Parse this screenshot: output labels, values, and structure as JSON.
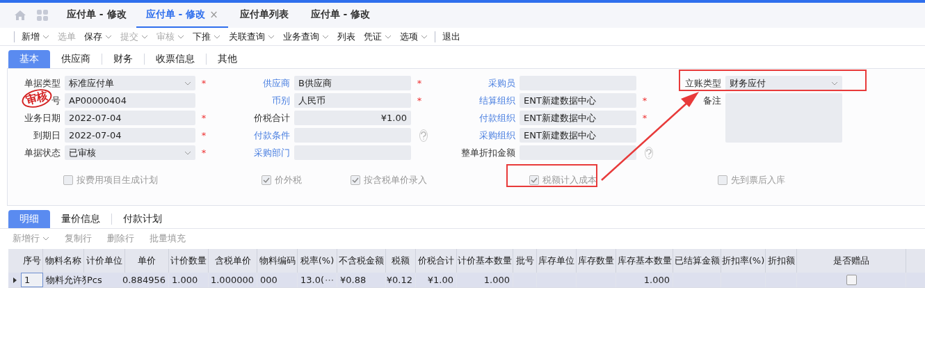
{
  "tabs": [
    {
      "label": "应付单 - 修改",
      "selected": false
    },
    {
      "label": "应付单 - 修改",
      "selected": true,
      "close": "×"
    },
    {
      "label": "应付单列表",
      "selected": false
    },
    {
      "label": "应付单 - 修改",
      "selected": false
    }
  ],
  "toolbar": [
    {
      "label": "新增",
      "menu": true,
      "disabled": false
    },
    {
      "label": "选单",
      "menu": false,
      "disabled": true
    },
    {
      "label": "保存",
      "menu": true,
      "disabled": false
    },
    {
      "label": "提交",
      "menu": true,
      "disabled": true
    },
    {
      "label": "审核",
      "menu": true,
      "disabled": true
    },
    {
      "label": "下推",
      "menu": true,
      "disabled": false
    },
    {
      "label": "关联查询",
      "menu": true,
      "disabled": false
    },
    {
      "label": "业务查询",
      "menu": true,
      "disabled": false
    },
    {
      "label": "列表",
      "menu": false,
      "disabled": false
    },
    {
      "label": "凭证",
      "menu": true,
      "disabled": false
    },
    {
      "label": "选项",
      "menu": true,
      "disabled": false
    },
    {
      "label": "退出",
      "menu": false,
      "disabled": false
    }
  ],
  "form_tabs": [
    {
      "label": "基本",
      "selected": true
    },
    {
      "label": "供应商",
      "selected": false
    },
    {
      "label": "财务",
      "selected": false
    },
    {
      "label": "收票信息",
      "selected": false
    },
    {
      "label": "其他",
      "selected": false
    }
  ],
  "stamp": "审核",
  "form_groups": [
    [
      {
        "label": "单据类型",
        "kind": "select",
        "value": "标准应付单",
        "mark": "*",
        "link": false
      },
      {
        "label": "号",
        "kind": "text",
        "value": "AP00000404",
        "link": false
      },
      {
        "label": "业务日期",
        "kind": "text",
        "value": "2022-07-04",
        "mark": "*",
        "link": false
      },
      {
        "label": "到期日",
        "kind": "text",
        "value": "2022-07-04",
        "mark": "*",
        "link": false
      },
      {
        "label": "单据状态",
        "kind": "select",
        "value": "已审核",
        "mark": "*",
        "link": false
      }
    ],
    [
      {
        "label": "供应商",
        "kind": "text",
        "value": "B供应商",
        "mark": "*",
        "link": true
      },
      {
        "label": "币别",
        "kind": "text",
        "value": "人民币",
        "mark": "*",
        "link": true
      },
      {
        "label": "价税合计",
        "kind": "amount",
        "value": "¥1.00",
        "link": false
      },
      {
        "label": "付款条件",
        "kind": "help",
        "link": true
      },
      {
        "label": "采购部门",
        "kind": "text",
        "link": true
      }
    ],
    [
      {
        "label": "采购员",
        "kind": "text",
        "link": true
      },
      {
        "label": "结算组织",
        "kind": "text",
        "value": "ENT新建数据中心",
        "mark": "*",
        "link": true
      },
      {
        "label": "付款组织",
        "kind": "text",
        "value": "ENT新建数据中心",
        "mark": "*",
        "link": true
      },
      {
        "label": "采购组织",
        "kind": "text",
        "value": "ENT新建数据中心",
        "link": true
      },
      {
        "label": "整单折扣金额",
        "kind": "help",
        "link": false
      }
    ],
    [
      {
        "label": "立账类型",
        "kind": "select",
        "value": "财务应付",
        "link": false
      },
      {
        "label": "备注",
        "kind": "textarea",
        "link": false
      }
    ]
  ],
  "checkboxes": [
    {
      "label": "按费用项目生成计划",
      "checked": false
    },
    {
      "label": "价外税",
      "checked": true
    },
    {
      "label": "按含税单价录入",
      "checked": true
    },
    {
      "label": "税额计入成本",
      "checked": true
    },
    {
      "label": "先到票后入库",
      "checked": false
    }
  ],
  "detail_tabs": [
    {
      "label": "明细",
      "selected": true
    },
    {
      "label": "量价信息",
      "selected": false
    },
    {
      "label": "付款计划",
      "selected": false
    }
  ],
  "detail_toolbar": [
    {
      "label": "新增行",
      "menu": true
    },
    {
      "label": "复制行",
      "menu": false
    },
    {
      "label": "删除行",
      "menu": false
    },
    {
      "label": "批量填充",
      "menu": false
    }
  ],
  "table": {
    "columns": [
      "序号",
      "物料名称",
      "计价单位",
      "单价",
      "计价数量",
      "含税单价",
      "物料编码",
      "税率(%)",
      "不含税金额",
      "税额",
      "价税合计",
      "计价基本数量",
      "批号",
      "库存单位",
      "库存数量",
      "库存基本数量",
      "已结算金额",
      "折扣率(%)",
      "折扣额",
      "是否赠品"
    ],
    "rows": [
      {
        "selected": true,
        "gift": false,
        "cells": [
          "1",
          "物料允许犭",
          "Pcs",
          "0.884956",
          "1.000",
          "1.000000",
          "000",
          {
            "text": "13.0(",
            "more": "⋯"
          },
          "¥0.88",
          "¥0.12",
          "¥1.00",
          "1.000",
          null,
          null,
          null,
          "1.000",
          null,
          null,
          null
        ]
      }
    ]
  }
}
